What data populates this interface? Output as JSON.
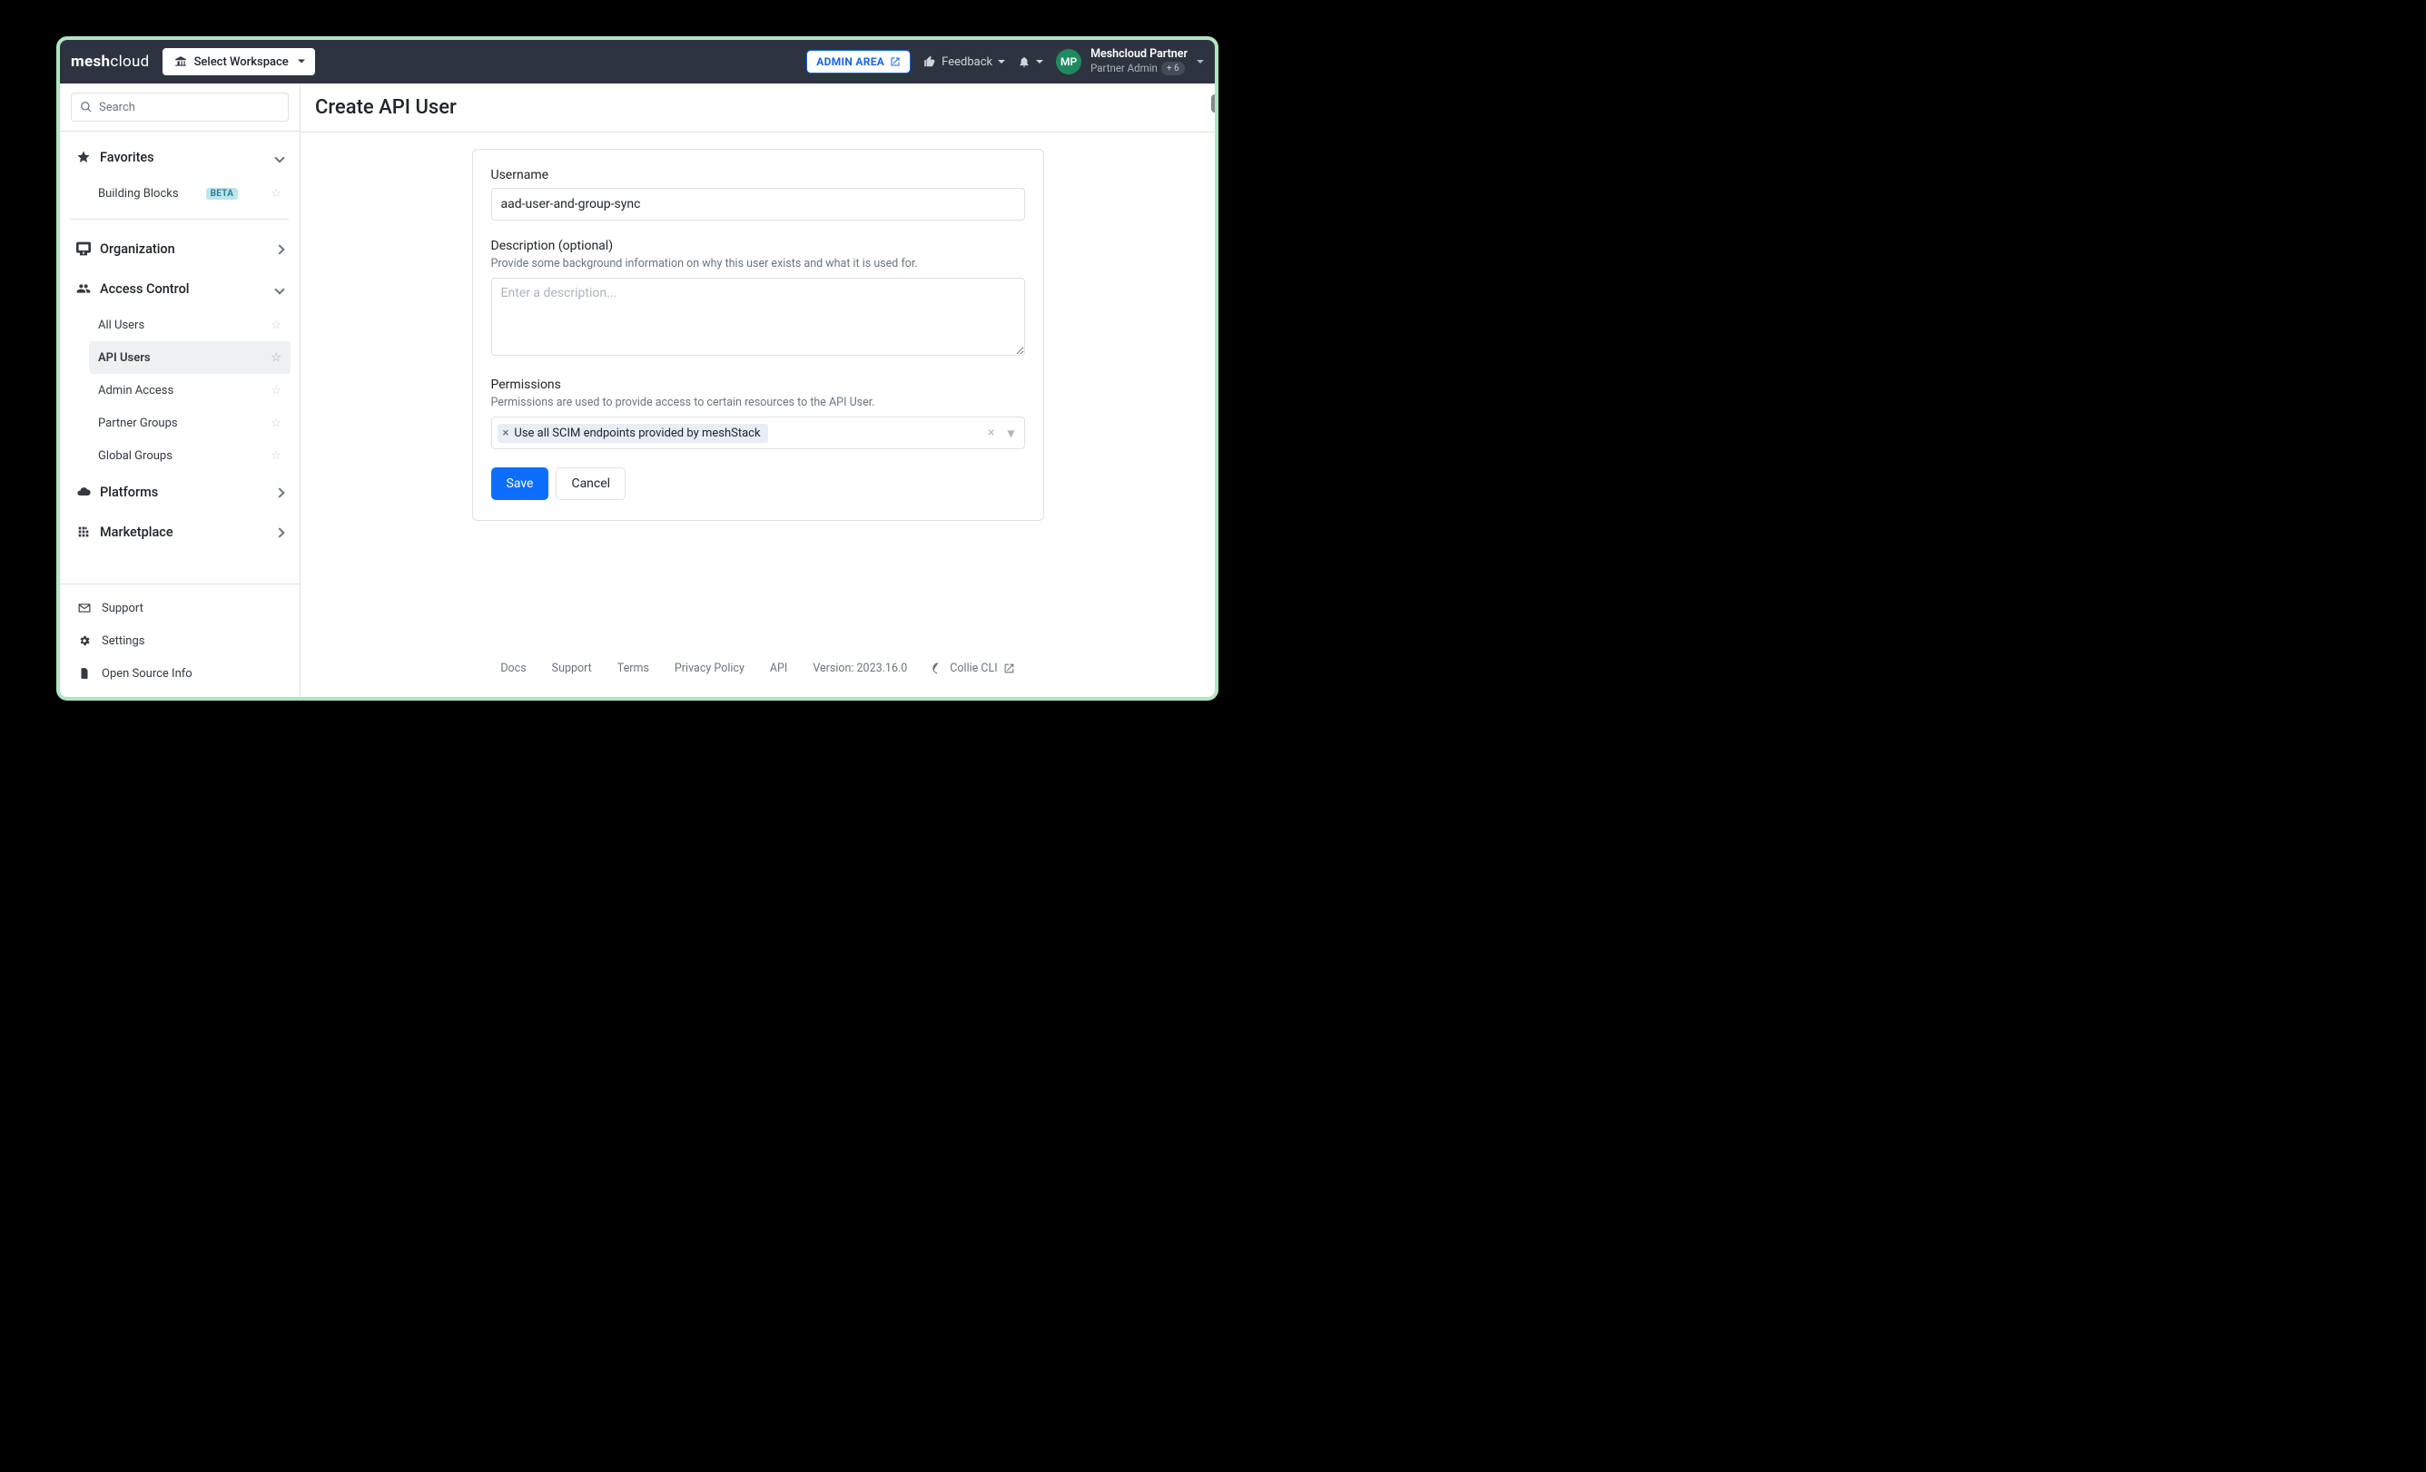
{
  "brand": {
    "prefix": "mesh",
    "suffix": "cloud"
  },
  "workspace_selector": {
    "label": "Select Workspace"
  },
  "header": {
    "admin_area": "ADMIN AREA",
    "feedback": "Feedback",
    "user": {
      "initials": "MP",
      "name": "Meshcloud Partner",
      "role": "Partner Admin",
      "extra": "+ 6"
    }
  },
  "search": {
    "placeholder": "Search"
  },
  "sidebar": {
    "favorites": {
      "label": "Favorites"
    },
    "favorite_items": [
      {
        "label": "Building Blocks",
        "beta": true
      }
    ],
    "sections": [
      {
        "key": "org",
        "label": "Organization",
        "expanded": false
      },
      {
        "key": "access",
        "label": "Access Control",
        "expanded": true,
        "items": [
          {
            "label": "All Users"
          },
          {
            "label": "API Users",
            "active": true
          },
          {
            "label": "Admin Access"
          },
          {
            "label": "Partner Groups"
          },
          {
            "label": "Global Groups"
          }
        ]
      },
      {
        "key": "platforms",
        "label": "Platforms",
        "expanded": false
      },
      {
        "key": "market",
        "label": "Marketplace",
        "expanded": false
      }
    ],
    "footer": [
      {
        "label": "Support",
        "icon": "mail"
      },
      {
        "label": "Settings",
        "icon": "gear"
      },
      {
        "label": "Open Source Info",
        "icon": "file"
      }
    ]
  },
  "page": {
    "title": "Create API User",
    "username": {
      "label": "Username",
      "value": "aad-user-and-group-sync"
    },
    "description": {
      "label": "Description (optional)",
      "hint": "Provide some background information on why this user exists and what it is used for.",
      "placeholder": "Enter a description..."
    },
    "permissions": {
      "label": "Permissions",
      "hint": "Permissions are used to provide access to certain resources to the API User.",
      "tags": [
        "Use all SCIM endpoints provided by meshStack"
      ]
    },
    "buttons": {
      "save": "Save",
      "cancel": "Cancel"
    }
  },
  "footer": {
    "links": [
      "Docs",
      "Support",
      "Terms",
      "Privacy Policy",
      "API"
    ],
    "version": "Version: 2023.16.0",
    "collie": "Collie CLI"
  }
}
